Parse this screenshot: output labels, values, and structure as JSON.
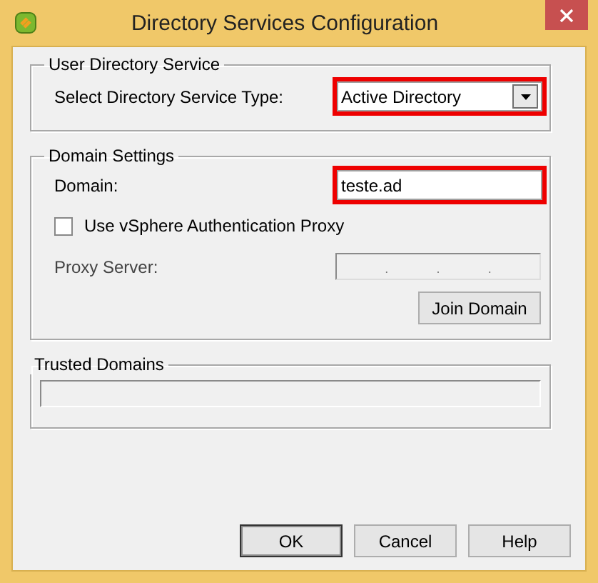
{
  "window": {
    "title": "Directory Services Configuration"
  },
  "user_directory_service": {
    "legend": "User Directory Service",
    "label": "Select Directory Service Type:",
    "value": "Active Directory",
    "highlighted": true
  },
  "domain_settings": {
    "legend": "Domain Settings",
    "domain_label": "Domain:",
    "domain_value": "teste.ad",
    "domain_highlighted": true,
    "proxy_checkbox": {
      "label": "Use vSphere Authentication Proxy",
      "checked": false
    },
    "proxy_server": {
      "label": "Proxy Server:",
      "disabled": true,
      "separators": [
        ".",
        ".",
        "."
      ]
    },
    "join_button": "Join Domain"
  },
  "trusted_domains": {
    "legend": "Trusted Domains"
  },
  "buttons": [
    {
      "label": "OK",
      "default": true
    },
    {
      "label": "Cancel",
      "default": false
    },
    {
      "label": "Help",
      "default": false
    }
  ]
}
